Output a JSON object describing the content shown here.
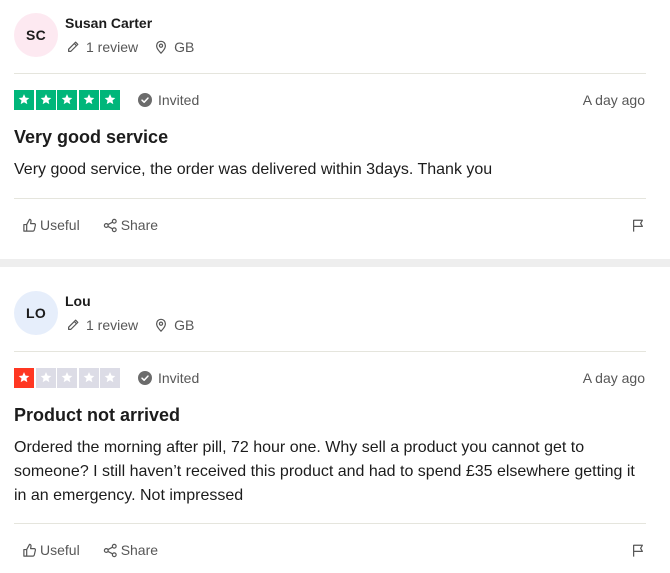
{
  "reviews": [
    {
      "initials": "SC",
      "avatar_color": "#fde9f1",
      "name": "Susan Carter",
      "review_count": "1 review",
      "country": "GB",
      "rating": 5,
      "star_color": "#00b67a",
      "badge": "Invited",
      "date": "A day ago",
      "title": "Very good service",
      "body": "Very good service, the order was delivered within 3days. Thank you",
      "useful_label": "Useful",
      "share_label": "Share"
    },
    {
      "initials": "LO",
      "avatar_color": "#e6eefb",
      "name": "Lou",
      "review_count": "1 review",
      "country": "GB",
      "rating": 1,
      "star_color": "#ff3722",
      "badge": "Invited",
      "date": "A day ago",
      "title": "Product not arrived",
      "body": "Ordered the morning after pill, 72 hour one. Why sell a product you cannot get to someone? I still haven’t received this product and had to spend £35 elsewhere getting it in an emergency. Not impressed",
      "useful_label": "Useful",
      "share_label": "Share"
    }
  ],
  "colors": {
    "empty_star": "#dcdce6",
    "muted_text": "#575757",
    "divider": "#e5e5dd"
  }
}
